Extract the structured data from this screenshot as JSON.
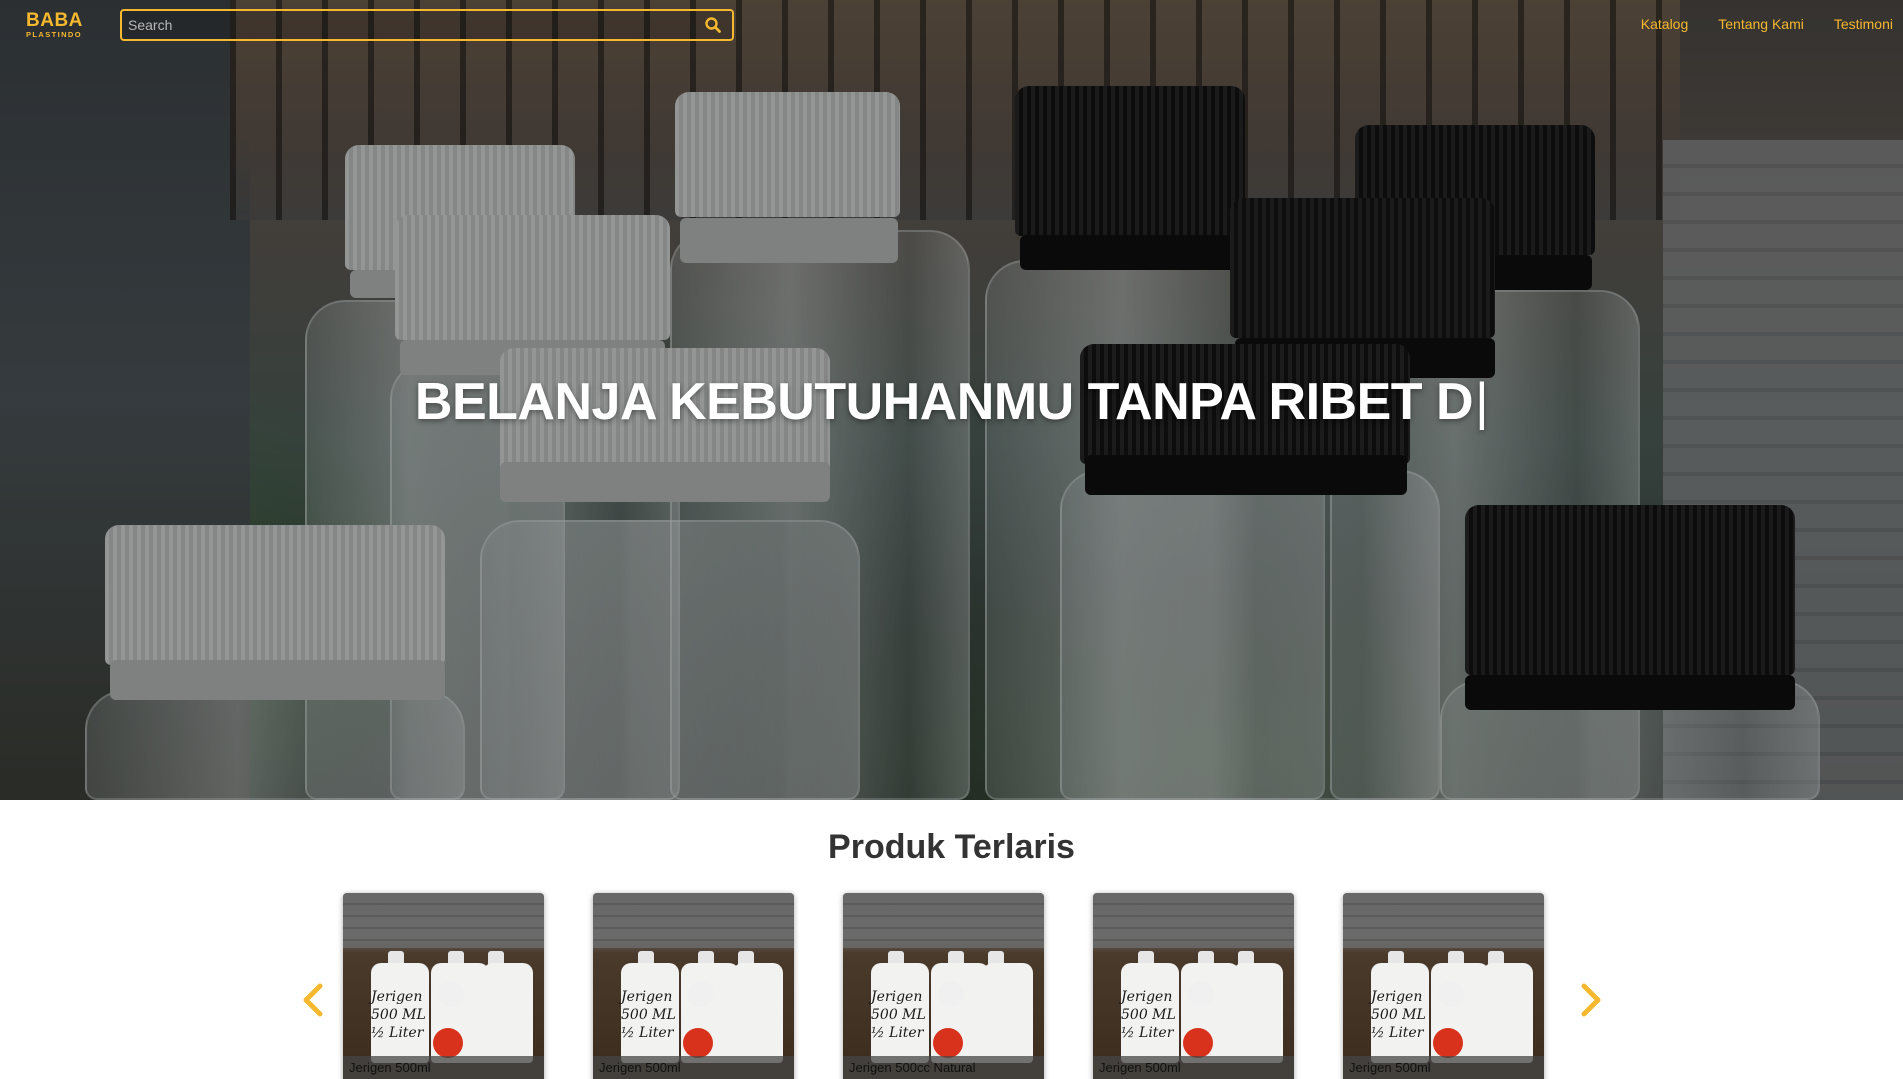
{
  "navbar": {
    "logo_main": "BABA",
    "logo_sub": "PLASTINDO",
    "search_placeholder": "Search",
    "links": [
      "Katalog",
      "Tentang Kami",
      "Testimoni"
    ]
  },
  "hero": {
    "headline": "BELANJA KEBUTUHANMU TANPA RIBET D",
    "caret": "|"
  },
  "products": {
    "section_title": "Produk Terlaris",
    "items": [
      {
        "name": "Jerigen 500ml"
      },
      {
        "name": "Jerigen 500ml"
      },
      {
        "name": "Jerigen 500cc Natural"
      },
      {
        "name": "Jerigen 500ml"
      },
      {
        "name": "Jerigen 500ml"
      }
    ],
    "product_image_text": [
      "Jerigen",
      "500 ML",
      "½ Liter"
    ]
  },
  "icons": {
    "search": "search-icon",
    "prev": "chevron-left-icon",
    "next": "chevron-right-icon"
  },
  "colors": {
    "accent": "#f5b82e",
    "title_text": "#333333",
    "hero_text": "#ffffff"
  }
}
